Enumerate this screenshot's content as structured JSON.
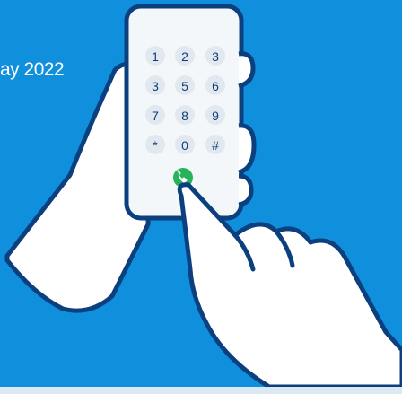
{
  "caption": {
    "date_text": "ay 2022"
  },
  "dialpad": {
    "keys": [
      "1",
      "2",
      "3",
      "3",
      "5",
      "6",
      "7",
      "8",
      "9",
      "*",
      "0",
      "#"
    ]
  },
  "colors": {
    "background": "#0f8fdc",
    "outline": "#0b3f7d",
    "hand_fill": "#ffffff",
    "phone_body": "#f4f7fa",
    "key_fill": "#e2e8ef",
    "call_button": "#27b35a",
    "bottom_bar": "#dce9f2"
  },
  "icons": {
    "call": "phone-handset-icon"
  }
}
